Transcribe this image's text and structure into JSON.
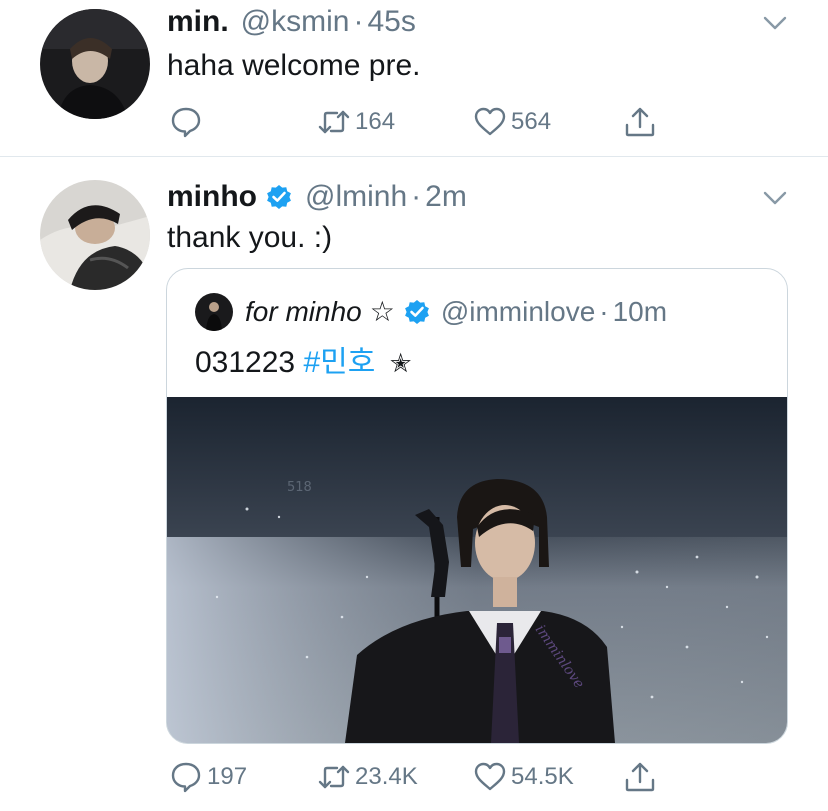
{
  "tweets": [
    {
      "name": "min.",
      "handle": "@ksmin",
      "separator": "·",
      "time": "45s",
      "text": "haha welcome pre.",
      "verified": false,
      "stats": {
        "replies": "",
        "retweets": "164",
        "likes": "564"
      }
    },
    {
      "name": "minho",
      "handle": "@lminh",
      "separator": "·",
      "time": "2m",
      "text": "thank you. :)",
      "verified": true,
      "stats": {
        "replies": "197",
        "retweets": "23.4K",
        "likes": "54.5K"
      }
    }
  ],
  "quoted_tweet": {
    "name": "for minho",
    "name_star": "☆",
    "handle": "@imminlove",
    "separator": "·",
    "time": "10m",
    "text_prefix": "031223",
    "hashtag": "#민호",
    "text_suffix": "✭",
    "media_watermark": "imminlove",
    "media_sign": "518"
  },
  "icons": {
    "reply": "reply-icon",
    "retweet": "retweet-icon",
    "like": "heart-icon",
    "share": "share-icon",
    "verified": "verified-badge-icon",
    "caret": "chevron-down-icon"
  },
  "colors": {
    "text": "#14171a",
    "muted": "#657786",
    "link": "#1da1f2",
    "verified": "#1da1f2",
    "divider": "#e1e8ed"
  }
}
